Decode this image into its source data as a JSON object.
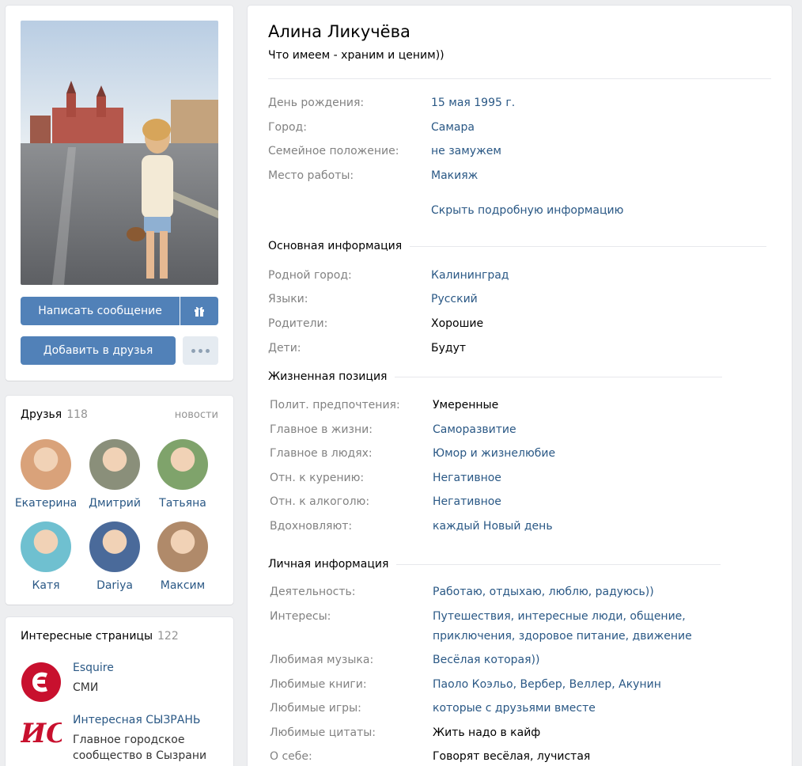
{
  "profile": {
    "name": "Алина Ликучёва",
    "status": "Что имеем - храним и ценим))",
    "send_message": "Написать сообщение",
    "add_friend": "Добавить в друзья"
  },
  "short_info": [
    {
      "label": "День рождения:",
      "value": "15 мая 1995 г.",
      "link": true
    },
    {
      "label": "Город:",
      "value": "Самара",
      "link": true
    },
    {
      "label": "Семейное положение:",
      "value": "не замужем",
      "link": true
    },
    {
      "label": "Место работы:",
      "value": "Макияж",
      "link": true
    }
  ],
  "hide_details": "Скрыть подробную информацию",
  "main_section": {
    "title": "Основная информация",
    "rows": [
      {
        "label": "Родной город:",
        "value": "Калининград",
        "link": true
      },
      {
        "label": "Языки:",
        "value": "Русский",
        "link": true
      },
      {
        "label": "Родители:",
        "value": "Хорошие",
        "link": false
      },
      {
        "label": "Дети:",
        "value": "Будут",
        "link": false
      }
    ]
  },
  "life_section": {
    "title": "Жизненная позиция",
    "rows": [
      {
        "label": "Полит. предпочтения:",
        "value": "Умеренные",
        "link": false
      },
      {
        "label": "Главное в жизни:",
        "value": "Саморазвитие",
        "link": true
      },
      {
        "label": "Главное в людях:",
        "value": "Юмор и жизнелюбие",
        "link": true
      },
      {
        "label": "Отн. к курению:",
        "value": "Негативное",
        "link": true
      },
      {
        "label": "Отн. к алкоголю:",
        "value": "Негативное",
        "link": true
      },
      {
        "label": "Вдохновляют:",
        "value": "каждый Новый день",
        "link": true
      }
    ]
  },
  "personal_section": {
    "title": "Личная информация",
    "rows": [
      {
        "label": "Деятельность:",
        "value": "Работаю, отдыхаю, люблю, радуюсь))",
        "link": true
      },
      {
        "label": "Интересы:",
        "value": "Путешествия, интересные люди, общение,",
        "value2": "приключения, здоровое питание, движение",
        "link": true
      },
      {
        "label": "Любимая музыка:",
        "value": "Весёлая которая))",
        "link": true
      },
      {
        "label": "Любимые книги:",
        "value": "Паоло Коэльо, Вербер, Веллер, Акунин",
        "link": true
      },
      {
        "label": "Любимые игры:",
        "value": "которые с друзьями вместе",
        "link": true
      },
      {
        "label": "Любимые цитаты:",
        "value": "Жить надо в кайф",
        "link": false
      },
      {
        "label": "О себе:",
        "value": "Говорят весёлая, лучистая",
        "link": false
      }
    ]
  },
  "friends": {
    "title": "Друзья",
    "count": "118",
    "news": "новости",
    "items": [
      {
        "name": "Екатерина",
        "color": "#d9a27a"
      },
      {
        "name": "Дмитрий",
        "color": "#8a8f7a"
      },
      {
        "name": "Татьяна",
        "color": "#7fa36b"
      },
      {
        "name": "Катя",
        "color": "#6fc0d0"
      },
      {
        "name": "Dariya",
        "color": "#4a6a9a"
      },
      {
        "name": "Максим",
        "color": "#b08a6a"
      }
    ]
  },
  "interesting_pages": {
    "title": "Интересные страницы",
    "count": "122",
    "items": [
      {
        "name": "Esquire",
        "desc": "СМИ",
        "logo": "Є"
      },
      {
        "name": "Интересная СЫЗРАНЬ",
        "desc": "Главное городское сообщество в Сызрани",
        "logo": "ИС"
      }
    ]
  },
  "colors": {
    "accent": "#5181b8",
    "link": "#2a5885",
    "label": "#828282",
    "logo_red": "#c8102e"
  }
}
